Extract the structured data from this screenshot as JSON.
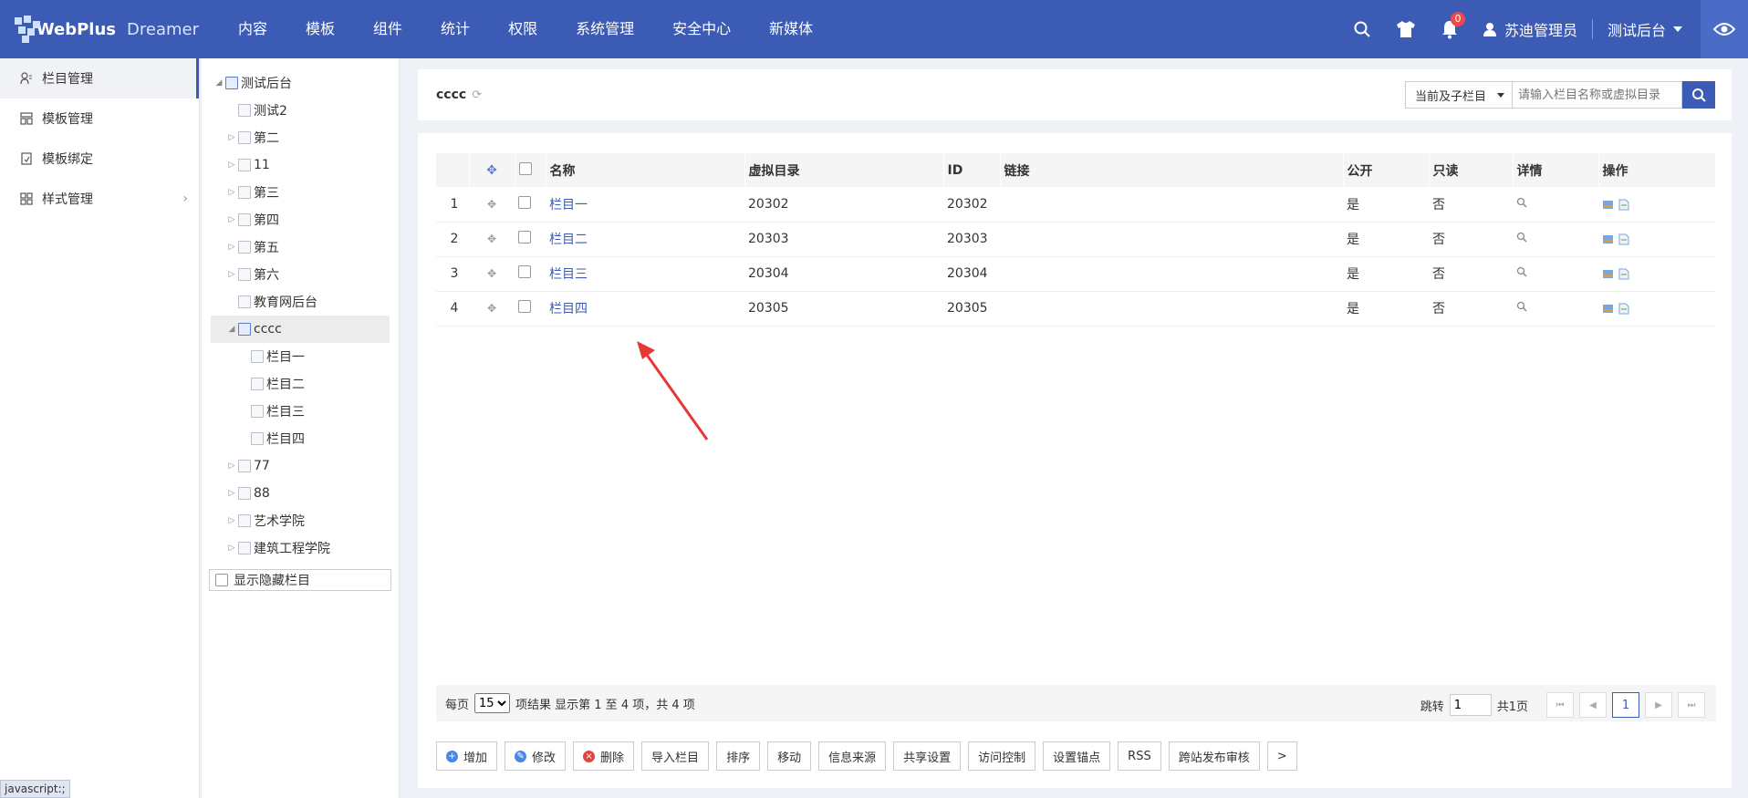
{
  "brand": {
    "name": "WebPlus",
    "product": "Dreamer"
  },
  "nav": [
    "内容",
    "模板",
    "组件",
    "统计",
    "权限",
    "系统管理",
    "安全中心",
    "新媒体"
  ],
  "header": {
    "notification_count": "0",
    "user": "苏迪管理员",
    "site": "测试后台"
  },
  "sidebar": {
    "items": [
      {
        "label": "栏目管理",
        "icon": "column-icon",
        "active": true
      },
      {
        "label": "模板管理",
        "icon": "template-icon"
      },
      {
        "label": "模板绑定",
        "icon": "bind-icon"
      },
      {
        "label": "样式管理",
        "icon": "style-icon",
        "has_children": true
      }
    ]
  },
  "tree": {
    "root": "测试后台",
    "nodes": [
      {
        "label": "测试2",
        "level": 1,
        "toggle": false
      },
      {
        "label": "第二",
        "level": 1,
        "toggle": true
      },
      {
        "label": "11",
        "level": 1,
        "toggle": true
      },
      {
        "label": "第三",
        "level": 1,
        "toggle": true
      },
      {
        "label": "第四",
        "level": 1,
        "toggle": true
      },
      {
        "label": "第五",
        "level": 1,
        "toggle": true
      },
      {
        "label": "第六",
        "level": 1,
        "toggle": true
      },
      {
        "label": "教育网后台",
        "level": 1,
        "toggle": false
      },
      {
        "label": "cccc",
        "level": 1,
        "toggle": "open",
        "selected": true
      },
      {
        "label": "栏目一",
        "level": 2,
        "toggle": false
      },
      {
        "label": "栏目二",
        "level": 2,
        "toggle": false
      },
      {
        "label": "栏目三",
        "level": 2,
        "toggle": false
      },
      {
        "label": "栏目四",
        "level": 2,
        "toggle": false
      },
      {
        "label": "77",
        "level": 1,
        "toggle": true
      },
      {
        "label": "88",
        "level": 1,
        "toggle": true
      },
      {
        "label": "艺术学院",
        "level": 1,
        "toggle": true
      },
      {
        "label": "建筑工程学院",
        "level": 1,
        "toggle": true
      }
    ],
    "show_hidden_label": "显示隐藏栏目"
  },
  "main": {
    "breadcrumb": "cccc",
    "search": {
      "scope": "当前及子栏目",
      "placeholder": "请输入栏目名称或虚拟目录"
    },
    "table": {
      "headers": [
        "名称",
        "虚拟目录",
        "ID",
        "链接",
        "公开",
        "只读",
        "详情",
        "操作"
      ],
      "rows": [
        {
          "index": "1",
          "name": "栏目一",
          "vdir": "20302",
          "id": "20302",
          "link": "",
          "public": "是",
          "readonly": "否"
        },
        {
          "index": "2",
          "name": "栏目二",
          "vdir": "20303",
          "id": "20303",
          "link": "",
          "public": "是",
          "readonly": "否"
        },
        {
          "index": "3",
          "name": "栏目三",
          "vdir": "20304",
          "id": "20304",
          "link": "",
          "public": "是",
          "readonly": "否"
        },
        {
          "index": "4",
          "name": "栏目四",
          "vdir": "20305",
          "id": "20305",
          "link": "",
          "public": "是",
          "readonly": "否"
        }
      ]
    },
    "pager": {
      "per_page_label": "每页",
      "per_page": "15",
      "summary": "项结果 显示第 1 至 4 项，共 4 项",
      "jump_label": "跳转",
      "jump_value": "1",
      "total_pages": "共1页",
      "current_page": "1"
    },
    "actions": [
      "增加",
      "修改",
      "删除",
      "导入栏目",
      "排序",
      "移动",
      "信息来源",
      "共享设置",
      "访问控制",
      "设置锚点",
      "RSS",
      "跨站发布审核",
      ">"
    ]
  },
  "status_bar": "javascript:;"
}
